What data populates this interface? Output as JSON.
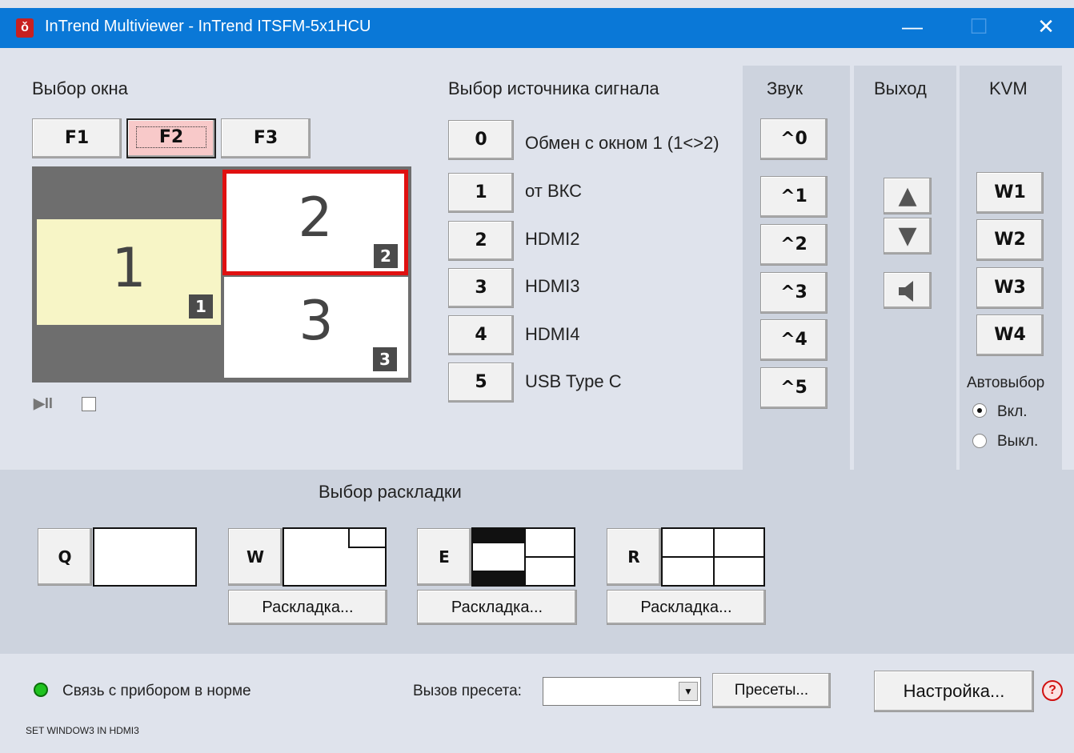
{
  "window": {
    "title": "InTrend Multiviewer - InTrend ITSFM-5x1HCU",
    "app_icon": "shield-icon",
    "minimize": "—",
    "maximize": "☐",
    "close": "✕"
  },
  "window_select": {
    "heading": "Выбор окна",
    "tabs": [
      "F1",
      "F2",
      "F3"
    ],
    "selected_tab": "F2",
    "windows": [
      {
        "big": "1",
        "badge": "1"
      },
      {
        "big": "2",
        "badge": "2"
      },
      {
        "big": "3",
        "badge": "3"
      }
    ],
    "play_pause": "▶II"
  },
  "source_select": {
    "heading": "Выбор источника сигнала",
    "sources": [
      {
        "key": "0",
        "label": "Обмен с окном 1 (1<>2)"
      },
      {
        "key": "1",
        "label": "от ВКС"
      },
      {
        "key": "2",
        "label": "HDMI2"
      },
      {
        "key": "3",
        "label": "HDMI3"
      },
      {
        "key": "4",
        "label": "HDMI4"
      },
      {
        "key": "5",
        "label": "USB Type C"
      }
    ]
  },
  "sound": {
    "heading": "Звук",
    "buttons": [
      "^0",
      "^1",
      "^2",
      "^3",
      "^4",
      "^5"
    ]
  },
  "output": {
    "heading": "Выход",
    "up": "▲",
    "down": "▼",
    "mute": "speaker-icon"
  },
  "kvm": {
    "heading": "KVM",
    "buttons": [
      "W1",
      "W2",
      "W3",
      "W4"
    ],
    "autoselect_label": "Автовыбор",
    "on_label": "Вкл.",
    "off_label": "Выкл.",
    "selected": "Вкл."
  },
  "layout_select": {
    "heading": "Выбор раскладки",
    "layouts": [
      {
        "key": "Q"
      },
      {
        "key": "W",
        "config_label": "Раскладка..."
      },
      {
        "key": "E",
        "config_label": "Раскладка..."
      },
      {
        "key": "R",
        "config_label": "Раскладка..."
      }
    ]
  },
  "status": {
    "connection_text": "Связь с прибором в норме",
    "indicator_color": "#1fc21f",
    "log_text": "SET WINDOW3 IN HDMI3",
    "preset_label": "Вызов пресета:",
    "preset_value": "",
    "presets_button": "Пресеты...",
    "settings_button": "Настройка...",
    "help_icon": "?"
  },
  "colors": {
    "titlebar": "#0a78d7",
    "selected_window_border": "#e01010",
    "window1_fill": "#f7f5c6",
    "selected_tab_fill": "#f8c9c9"
  }
}
